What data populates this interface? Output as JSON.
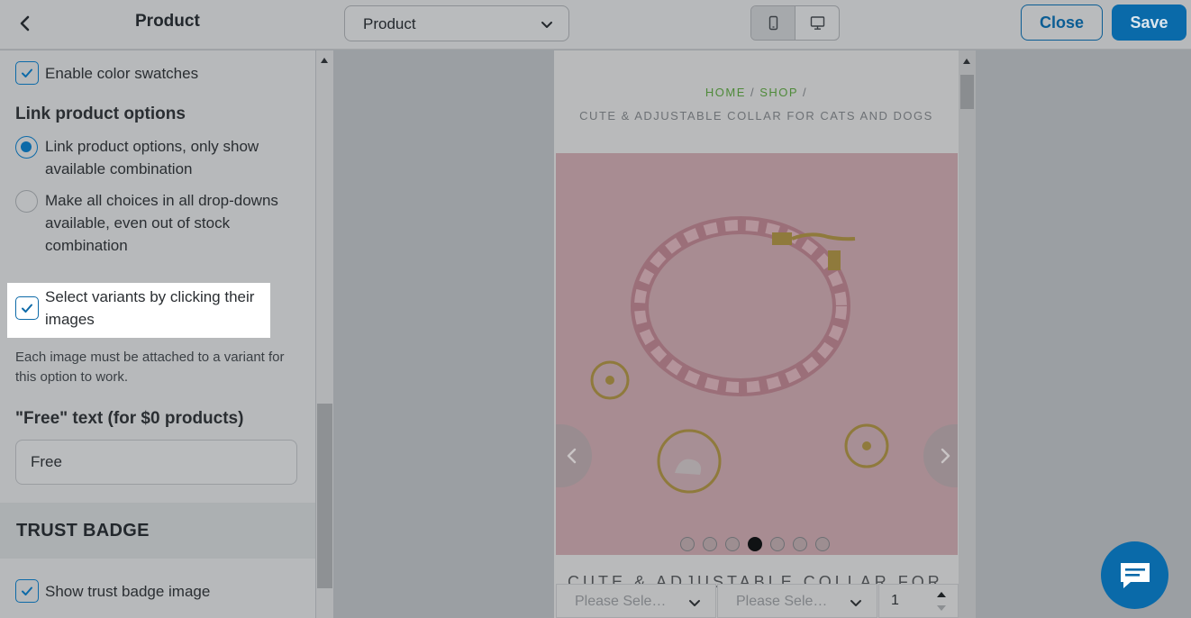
{
  "topbar": {
    "title": "Product",
    "page_select_value": "Product",
    "close_label": "Close",
    "save_label": "Save",
    "accent_color": "#0a6aa9"
  },
  "sidebar": {
    "enable_swatches_label": "Enable color swatches",
    "enable_swatches_checked": true,
    "link_options_heading": "Link product options",
    "radio_option_1": "Link product options, only show available combination",
    "radio_option_2": "Make all choices in all drop-downs available, even out of stock combination",
    "radio_selected_index": 0,
    "select_variants_label": "Select variants by clicking their images",
    "select_variants_checked": true,
    "select_variants_help": "Each image must be attached to a variant for this option to work.",
    "free_text_heading": "\"Free\" text (for $0 products)",
    "free_text_value": "Free",
    "trust_badge_heading": "TRUST BADGE",
    "show_trust_badge_label": "Show trust badge image",
    "show_trust_badge_checked": true
  },
  "preview": {
    "breadcrumb_home": "HOME",
    "breadcrumb_sep1": " / ",
    "breadcrumb_shop": "SHOP",
    "breadcrumb_sep2": " / ",
    "breadcrumb_current": "CUTE & ADJUSTABLE COLLAR FOR CATS AND DOGS",
    "product_title": "CUTE & ADJUSTABLE COLLAR FOR",
    "slide_count": 7,
    "active_slide_index": 3,
    "option1_placeholder": "Please Sele…",
    "option2_placeholder": "Please Sele…",
    "quantity_value": "1"
  },
  "icons": {
    "back": "chevron-left-icon",
    "dropdown": "chevron-down-icon",
    "mobile": "mobile-device-icon",
    "desktop": "desktop-monitor-icon",
    "chat": "chat-bubble-icon"
  }
}
